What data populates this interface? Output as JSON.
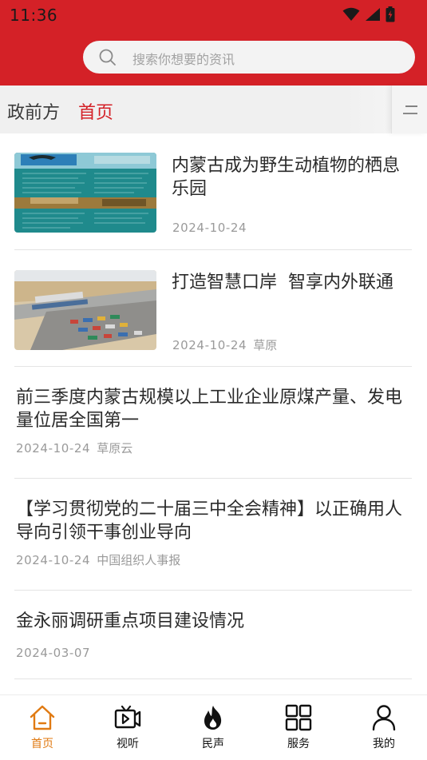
{
  "status_bar": {
    "time": "11:36"
  },
  "search": {
    "placeholder": "搜索你想要的资讯"
  },
  "channels": [
    {
      "label": "政前方",
      "active": false
    },
    {
      "label": "首页",
      "active": true
    }
  ],
  "news": [
    {
      "title": "内蒙古成为野生动植物的栖息乐园",
      "date": "2024-10-24",
      "source": "",
      "has_image": true
    },
    {
      "title": "打造智慧口岸  智享内外联通",
      "date": "2024-10-24",
      "source": "草原",
      "has_image": true
    },
    {
      "title": "前三季度内蒙古规模以上工业企业原煤产量、发电量位居全国第一",
      "date": "2024-10-24",
      "source": "草原云",
      "has_image": false
    },
    {
      "title": "【学习贯彻党的二十届三中全会精神】以正确用人导向引领干事创业导向",
      "date": "2024-10-24",
      "source": "中国组织人事报",
      "has_image": false
    },
    {
      "title": "金永丽调研重点项目建设情况",
      "date": "2024-03-07",
      "source": "",
      "has_image": false
    }
  ],
  "tabs": [
    {
      "label": "首页",
      "icon": "home-icon",
      "active": true
    },
    {
      "label": "视听",
      "icon": "video-icon",
      "active": false
    },
    {
      "label": "民声",
      "icon": "fire-icon",
      "active": false
    },
    {
      "label": "服务",
      "icon": "grid-icon",
      "active": false
    },
    {
      "label": "我的",
      "icon": "user-icon",
      "active": false
    }
  ],
  "colors": {
    "brand": "#d42127",
    "active_tab": "#e07a12",
    "meta_text": "#9a9a9a"
  }
}
